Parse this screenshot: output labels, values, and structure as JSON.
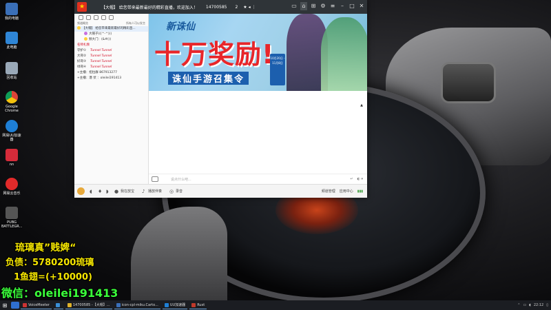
{
  "desktop_icons": [
    {
      "label": "我的电脑",
      "color": "#3a6fb8"
    },
    {
      "label": "此电脑",
      "color": "#2f86d7"
    },
    {
      "label": "回收站",
      "color": "#9aa9b8"
    },
    {
      "label": "Google Chrome",
      "color": "#e8b530"
    },
    {
      "label": "网易UU加速器",
      "color": "#1e7fd6"
    },
    {
      "label": "nn",
      "color": "#d62b3a"
    },
    {
      "label": "网易云音乐",
      "color": "#e22a2a"
    },
    {
      "label": "PUBG BATTLEGR...",
      "color": "#555555"
    }
  ],
  "overlay": {
    "line1": "琉璃真”贱婢“",
    "line2": "负债：5780200琉璃",
    "line3": "1鱼翅=(+10000)",
    "line4": "微信：oleilei191413"
  },
  "app": {
    "title": "【大帽】 给您带来最新最好的精彩直播，欢迎加入！",
    "room_id": "14700585",
    "user_count": "2",
    "left_panel": {
      "header_left": "频道概览",
      "header_right": "所有人可以发言",
      "channels": [
        {
          "label": "【大帽】 给您带来最新最好的精彩直..."
        },
        {
          "label": "大帽子(((^-^)))"
        },
        {
          "label": "频大门：(&#())"
        },
        {
          "label": "名师扎频"
        },
        {
          "label": "守护①",
          "tag": "Tunnel Tunnel"
        },
        {
          "label": "大哥②",
          "tag": "Tunnel Tunnel"
        },
        {
          "label": "好哥③",
          "tag": "Tunnel Tunnel"
        },
        {
          "label": "绿哥④",
          "tag": "Tunnel Tunnel"
        },
        {
          "label": "+主播：招拉群 867913277"
        },
        {
          "label": "+主播：潜 伏 ：oleilei191413"
        }
      ]
    },
    "banner": {
      "logo": "新诛仙",
      "headline": "十万奖励!",
      "subline": "诛仙手游召集令",
      "badge": "10月20日 - 11月8日"
    },
    "input_placeholder": "说点什么吧...",
    "status_bar": {
      "items": [
        "我在放宝",
        "播放伴奏",
        "录音"
      ],
      "right_items": [
        "频道管理",
        "应用中心"
      ]
    }
  },
  "taskbar": {
    "tasks": [
      {
        "label": "VoiceMeeter",
        "color": "#c33"
      },
      {
        "label": "",
        "color": "#3a8fd6"
      },
      {
        "label": "14700585 -【大帽】...",
        "color": "#e0b22a"
      },
      {
        "label": "icon-cpl-miku.Carto...",
        "color": "#3a6fb8"
      },
      {
        "label": "UU加速器",
        "color": "#1e7fd6"
      },
      {
        "label": "Rust",
        "color": "#c0392b"
      }
    ],
    "time": "22:12"
  }
}
